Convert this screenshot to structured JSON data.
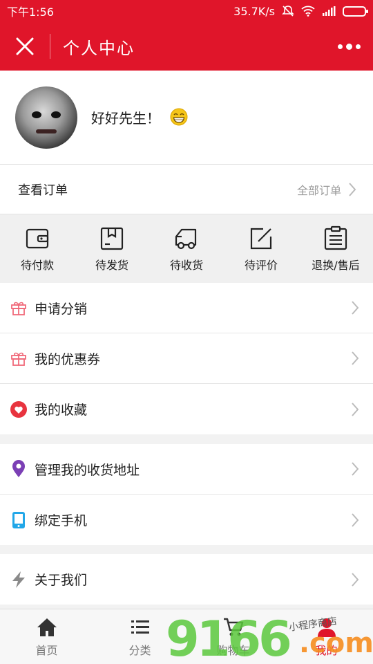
{
  "status_bar": {
    "time": "下午1:56",
    "speed": "35.7K/s"
  },
  "header": {
    "title": "个人中心"
  },
  "profile": {
    "username": "好好先生！"
  },
  "orders": {
    "label": "查看订单",
    "all_label": "全部订单"
  },
  "order_status": [
    {
      "label": "待付款",
      "icon": "wallet-icon"
    },
    {
      "label": "待发货",
      "icon": "box-icon"
    },
    {
      "label": "待收货",
      "icon": "truck-icon"
    },
    {
      "label": "待评价",
      "icon": "edit-icon"
    },
    {
      "label": "退换/售后",
      "icon": "clipboard-icon"
    }
  ],
  "menu_group_1": [
    {
      "label": "申请分销",
      "icon": "gift-icon"
    },
    {
      "label": "我的优惠券",
      "icon": "gift-icon"
    },
    {
      "label": "我的收藏",
      "icon": "heart-icon"
    }
  ],
  "menu_group_2": [
    {
      "label": "管理我的收货地址",
      "icon": "location-icon"
    },
    {
      "label": "绑定手机",
      "icon": "phone-icon"
    }
  ],
  "menu_group_3": [
    {
      "label": "关于我们",
      "icon": "lightning-icon"
    }
  ],
  "tabbar": [
    {
      "label": "首页",
      "icon": "home-icon"
    },
    {
      "label": "分类",
      "icon": "list-icon"
    },
    {
      "label": "购物车",
      "icon": "cart-icon"
    },
    {
      "label": "我的",
      "icon": "user-icon",
      "active": true
    }
  ],
  "watermark": {
    "main": "9166",
    "suffix": ".com",
    "small": "小程序商店"
  },
  "colors": {
    "brand": "#e0152a",
    "accent_green": "#5ac83c",
    "accent_orange": "#f58c1e"
  }
}
